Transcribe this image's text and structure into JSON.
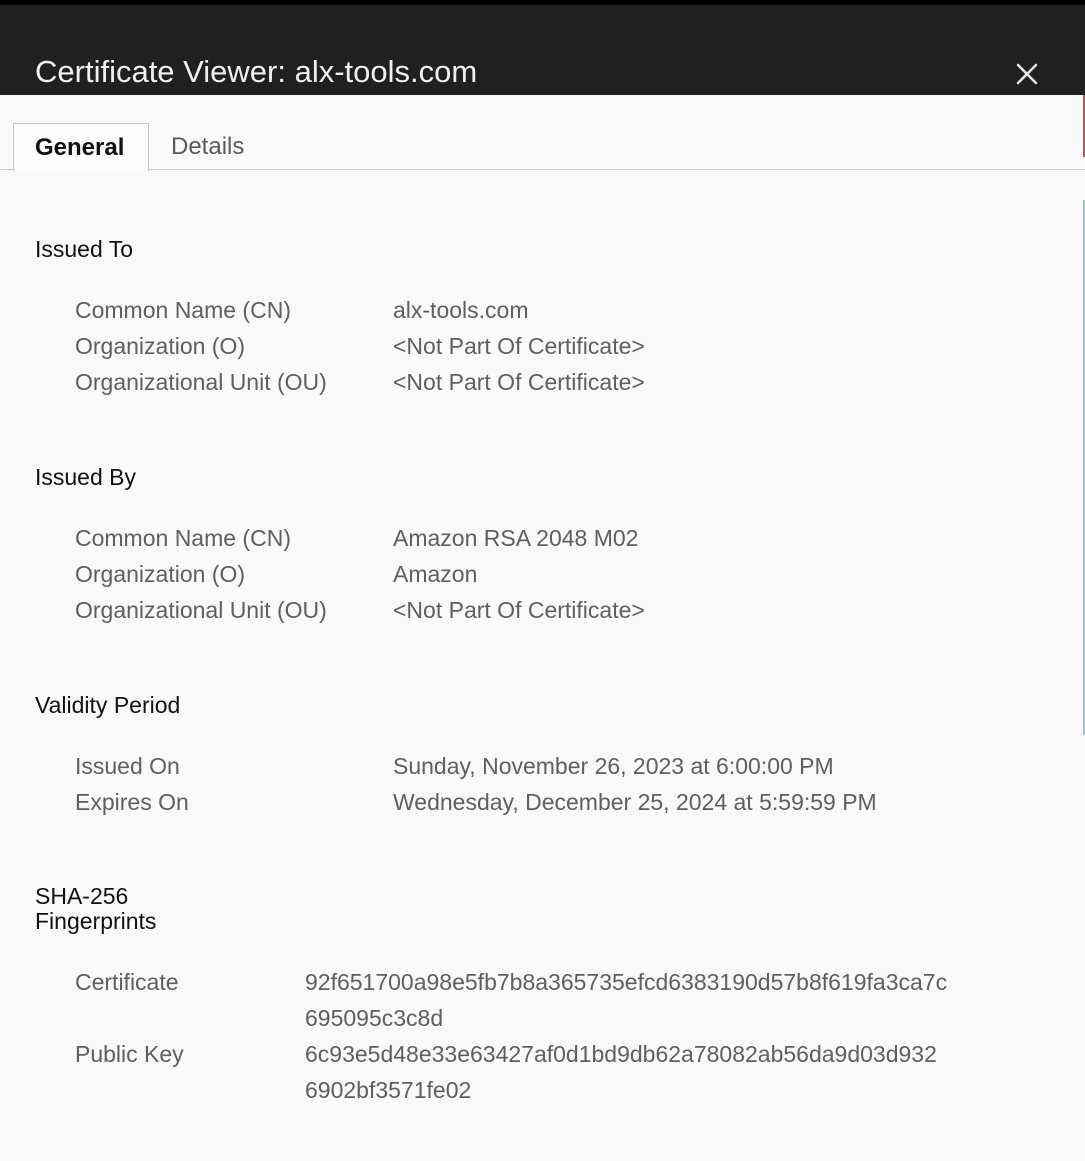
{
  "window": {
    "title": "Certificate Viewer: alx-tools.com",
    "close_icon": "close-icon"
  },
  "tabs": [
    {
      "label": "General",
      "active": true
    },
    {
      "label": "Details",
      "active": false
    }
  ],
  "issued_to": {
    "heading": "Issued To",
    "rows": [
      {
        "label": "Common Name (CN)",
        "value": "alx-tools.com"
      },
      {
        "label": "Organization (O)",
        "value": "<Not Part Of Certificate>"
      },
      {
        "label": "Organizational Unit (OU)",
        "value": "<Not Part Of Certificate>"
      }
    ]
  },
  "issued_by": {
    "heading": "Issued By",
    "rows": [
      {
        "label": "Common Name (CN)",
        "value": "Amazon RSA 2048 M02"
      },
      {
        "label": "Organization (O)",
        "value": "Amazon"
      },
      {
        "label": "Organizational Unit (OU)",
        "value": "<Not Part Of Certificate>"
      }
    ]
  },
  "validity": {
    "heading": "Validity Period",
    "rows": [
      {
        "label": "Issued On",
        "value": "Sunday, November 26, 2023 at 6:00:00 PM"
      },
      {
        "label": "Expires On",
        "value": "Wednesday, December 25, 2024 at 5:59:59 PM"
      }
    ]
  },
  "fingerprints": {
    "heading_line1": "SHA-256",
    "heading_line2": "Fingerprints",
    "rows": [
      {
        "label": "Certificate",
        "value_line1": "92f651700a98e5fb7b8a365735efcd6383190d57b8f619fa3ca7c",
        "value_line2": "695095c3c8d"
      },
      {
        "label": "Public Key",
        "value_line1": "6c93e5d48e33e63427af0d1bd9db62a78082ab56da9d03d932",
        "value_line2": "6902bf3571fe02"
      }
    ]
  },
  "colors": {
    "titlebar": "#202020",
    "background": "#f9f9f9",
    "label_text": "#5f5f5f",
    "heading_text": "#111111"
  }
}
